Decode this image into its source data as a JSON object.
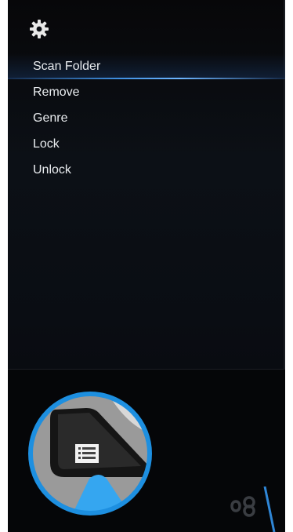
{
  "menu": {
    "items": [
      {
        "label": "Scan Folder",
        "selected": true
      },
      {
        "label": "Remove",
        "selected": false
      },
      {
        "label": "Genre",
        "selected": false
      },
      {
        "label": "Lock",
        "selected": false
      },
      {
        "label": "Unlock",
        "selected": false
      }
    ]
  },
  "icons": {
    "settings": "gear-icon",
    "remote_button": "menu-list-icon",
    "hand": "hand-pointer-icon",
    "channel": "channel-loop-icon"
  },
  "colors": {
    "panel_background": "#0a0d13",
    "selection_highlight": "#3f8fe0",
    "callout_ring": "#1d8fe0",
    "hand": "#35a6f0",
    "menu_text": "#e9ecef"
  }
}
